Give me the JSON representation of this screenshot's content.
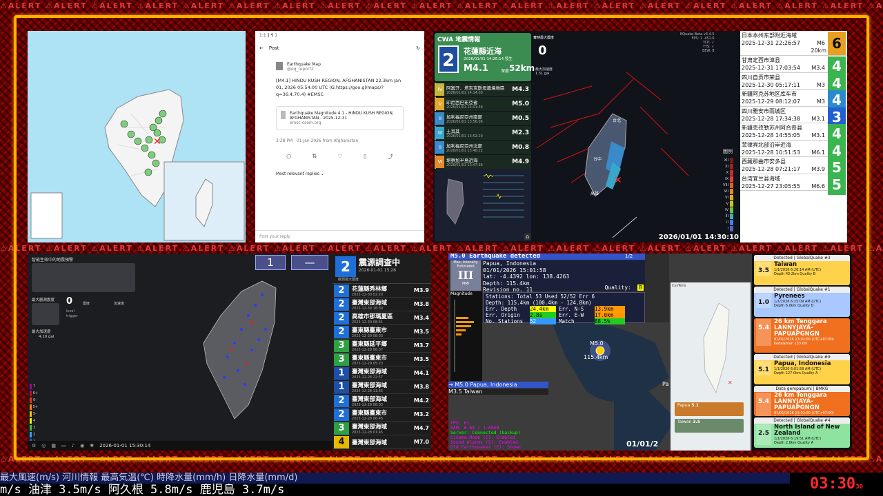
{
  "alert_word": "ALERT",
  "p2": {
    "status": "1:1 ‖ ¶ 1",
    "post": "Post",
    "account": "Earthquake Map",
    "handle": "@eq_report2",
    "body": "[M4.1] HINDU KUSH REGION, AFGHANISTAN 22.3km Jan 01, 2026 05:54:00 UTC (G:https://goo.gl/maps/?q=36.4,70.4) #EMSC",
    "quote_a": "Earthquake Magnitude 4.1 - HINDU KUSH REGION, AFGHANISTAN - 2025-12-31",
    "quote_b": "emsc-csem.org",
    "meta": "3:28 PM · 01 Jan 2026 from Afghanistan",
    "relevant": "Most relevant replies ⌄",
    "reply": "Post your reply"
  },
  "p3": {
    "header": "CWA 地震情報",
    "int": "2",
    "place": "花蓮縣近海",
    "dt": "2026/01/01 14:26:14 發生",
    "mag": "M4.1",
    "depth_l": "深度",
    "depth": "52km",
    "list": [
      {
        "i": "IV",
        "n": "阿富汗、塔吉克斯坦邊境地區",
        "m": "M4.3",
        "d": "2026/01/01 14:14:00",
        "c": "#c9b53a"
      },
      {
        "i": "V",
        "n": "印尼西巴布亞省",
        "m": "M5.0",
        "d": "2026/01/01 14:01:59",
        "c": "#e3a82a"
      },
      {
        "i": "II",
        "n": "加利福尼亞州南部",
        "m": "M0.5",
        "d": "2026/01/01 13:56:06",
        "c": "#3a8ac9"
      },
      {
        "i": "III",
        "n": "土耳其",
        "m": "M2.3",
        "d": "2026/01/01 13:52:20",
        "c": "#3aa6c9"
      },
      {
        "i": "II",
        "n": "加利福尼亞州北部",
        "m": "M0.8",
        "d": "2026/01/01 13:48:22",
        "c": "#3a8ac9"
      },
      {
        "i": "VI",
        "n": "堪察加半島近海",
        "m": "M4.9",
        "d": "2026/01/01 13:47:36",
        "c": "#e38a2a"
      }
    ],
    "zero": "0",
    "live": "實時最大震度",
    "pga_l": "最大加速度",
    "pga": "1.31 gal",
    "legend": "圖例",
    "legend_levels": [
      "XII",
      "XI",
      "X",
      "IX",
      "VIII",
      "VII",
      "VI",
      "V",
      "IV",
      "III",
      "II",
      "I"
    ],
    "ts": "2026/01/01 14:30:10",
    "info": "EQuake Beta v3.4.5\nFPS: 1  451.6\nTCP: ✓\nTTS: ✓\nEEW: 8",
    "city1": "台北",
    "city2": "台中",
    "city3": "高雄"
  },
  "list": [
    {
      "p": "日本本州东部附近海域",
      "t": "2025-12-31 22:26:57",
      "m": "M6",
      "d": "20km",
      "s": "6",
      "c": "#e8a020"
    },
    {
      "p": "甘肃定西市漳县",
      "t": "2025-12-31 17:03:54",
      "m": "M3.4",
      "s": "4",
      "c": "#3ab550"
    },
    {
      "p": "四川自贡市荣县",
      "t": "2025-12-30 05:17:11",
      "m": "M3",
      "s": "4",
      "c": "#3ab550"
    },
    {
      "p": "新疆阿克苏地区库车市",
      "t": "2025-12-29 08:12:07",
      "m": "M3",
      "s": "4",
      "c": "#2a8ad0"
    },
    {
      "p": "四川雅安市雨城区",
      "t": "2025-12-28 17:34:38",
      "m": "M3.1",
      "s": "3",
      "c": "#2060d0"
    },
    {
      "p": "新疆克孜勒苏州阿合奇县",
      "t": "2025-12-28 14:55:05",
      "m": "M3.1",
      "s": "4",
      "c": "#3ab550"
    },
    {
      "p": "菲律宾北部沿岸近海",
      "t": "2025-12-28 10:51:53",
      "m": "M6.1",
      "s": "4",
      "c": "#3ab550"
    },
    {
      "p": "西藏那曲市安多县",
      "t": "2025-12-28 07:21:17",
      "m": "M3.9",
      "s": "5",
      "c": "#3ab550"
    },
    {
      "p": "台湾宜兰县海域",
      "t": "2025-12-27 23:05:55",
      "m": "M6.6",
      "s": "5",
      "c": "#3ab550"
    }
  ],
  "p5": {
    "title": "智能生效中的地震預警",
    "lvl_l": "最大觀測震度",
    "zero": "0",
    "label_a": "震度",
    "label_b": "加速度",
    "lvl": "level",
    "trig": "trigger",
    "dash": "--",
    "pga_l": "最大加速度",
    "pga": "4.10 gal",
    "ts": "2026-01-01 15:30:14",
    "scale": [
      "7",
      "6+",
      "6-",
      "5+",
      "5-",
      "4",
      "3",
      "2",
      "1"
    ]
  },
  "p6": {
    "b1": "1",
    "b2": "—",
    "int": "2",
    "title": "震源調查中",
    "dt": "2026-01-01 15:26",
    "sub": "觀測最大震度",
    "rows": [
      {
        "s": "2",
        "n": "花蓮縣秀林鄉",
        "d": "2025-12-30 02:20",
        "m": "M3.9",
        "c": "#1e6fd8"
      },
      {
        "s": "2",
        "n": "臺灣東部海域",
        "d": "2025-12-30 16:39",
        "m": "M3.8",
        "c": "#1e6fd8"
      },
      {
        "s": "2",
        "n": "高雄市那瑪夏區",
        "d": "2025-12-30 08:41",
        "m": "M3.4",
        "c": "#1e6fd8"
      },
      {
        "s": "2",
        "n": "臺東縣臺東市",
        "d": "2025-12-29 08:03",
        "m": "M3.5",
        "c": "#1e6fd8"
      },
      {
        "s": "3",
        "n": "臺東縣延平鄉",
        "d": "2025-12-29 06:37",
        "m": "M3.7",
        "c": "#2ea043"
      },
      {
        "s": "3",
        "n": "臺東縣臺東市",
        "d": "2025-12-29 05:23",
        "m": "M3.5",
        "c": "#2ea043"
      },
      {
        "s": "1",
        "n": "臺灣東部海域",
        "d": "2025-12-28 22:57",
        "m": "M4.1",
        "c": "#1c4fa8"
      },
      {
        "s": "1",
        "n": "臺灣東部海域",
        "d": "2025-12-28 11:55",
        "m": "M3.8",
        "c": "#1c4fa8"
      },
      {
        "s": "2",
        "n": "臺灣東部海域",
        "d": "2025-12-28 08:03",
        "m": "M4.2",
        "c": "#1e6fd8"
      },
      {
        "s": "2",
        "n": "臺東縣臺東市",
        "d": "2025-12-28 06:45",
        "m": "M3.2",
        "c": "#1e6fd8"
      },
      {
        "s": "3",
        "n": "臺灣東部海域",
        "d": "2025-12-28 01:45",
        "m": "M4.7",
        "c": "#2ea043"
      },
      {
        "s": "4",
        "n": "臺灣東部海域",
        "d": "",
        "m": "M7.0",
        "c": "#e6b800"
      }
    ]
  },
  "p7": {
    "title": "M5.0 Earthquake detected",
    "page": "1/2",
    "mmi_l": "Max. Intensity",
    "mmi_e": "Estimated",
    "mmi": "III",
    "mmi_u": "MMI",
    "place": "Papua, Indonesia",
    "time": "01/01/2026 15:01:58",
    "latlon": "lat: -4.4392 lon: 138.4263",
    "depth": "Depth: 115.4km",
    "rev": "Revision no. 11",
    "quality": "Quality:",
    "quality_v": "B",
    "mag_l": "Magnitude",
    "stats": [
      "Stations: Total 53 Used 52/52 Err 6",
      "Depth: 115.4km (100.4km - 124.8km)"
    ],
    "err_d": "Err. Depth",
    "err_d_v": "24.4km",
    "err_ns": "Err. N-S",
    "err_ns_v": "13.9km",
    "err_o": "Err. Origin",
    "err_o_v": "2.8s",
    "err_ew": "Err. E-W",
    "err_ew_v": "17.0km",
    "nst": "No. Stations",
    "nst_v": "52",
    "match": "Match",
    "match_v": "88.5%",
    "epi_m": "M5.0",
    "epi_d": "115.4km",
    "list1": "→ M5.0 Papua, Indonesia",
    "list2": "M3.5 Taiwan",
    "stat": [
      "FPS: 61",
      "RAM: 0.64 / 1.00GB",
      "Server: Connected (backup)",
      "Cinema Mode (C): Enabled",
      "Sound Alarms (S): Enabled",
      "Old Earthquakes (E): Shown"
    ],
    "bottom": "01/01/2",
    "pl": "Pa"
  },
  "mini": {
    "app": "CysTeris",
    "c1": "Papua",
    "c1m": "5.1",
    "c2": "Taiwan",
    "c2m": "3.5"
  },
  "p8": [
    {
      "h": "Detected | GlobalQuake",
      "n": "#3",
      "m": "3.5",
      "place": "Taiwan",
      "t": "1/1/2026 6:26:14 AM (UTC)",
      "d": "Depth 43.2km",
      "q": "Quality B",
      "c": "#ffd24a",
      "tc": "#111"
    },
    {
      "h": "Detected | GlobalQuake",
      "n": "#1",
      "m": "1.0",
      "place": "Pyrenees",
      "t": "1/1/2026 6:25:09 AM (UTC)",
      "d": "Depth 6.0km",
      "q": "Quality D",
      "c": "#a8c8ff",
      "tc": "#111"
    },
    {
      "h": "",
      "n": "",
      "m": "5.4",
      "place": "26 km Tenggara LANNYJAYA-PAPUAPGNGN",
      "t": "01/01/2026 13:02:00 (UTC+07:00)",
      "d": "Kedalaman 133 km",
      "q": "",
      "c": "#f07020",
      "tc": "#fff"
    },
    {
      "h": "Detected | GlobalQuake",
      "n": "#9",
      "m": "5.1",
      "place": "Papua, Indonesia",
      "t": "1/1/2026 6:01:58 AM (UTC)",
      "d": "Depth 127.0km",
      "q": "Quality A",
      "c": "#ffd24a",
      "tc": "#111"
    },
    {
      "h": "Data gempabumi | BMKG",
      "n": "",
      "m": "5.4",
      "place": "26 km Tenggara LANNYJAYA-PAPUAPGNGN",
      "t": "01/01/2026 13:02:00 (UTC+07:00)",
      "d": "Kedalaman 133 km",
      "q": "",
      "c": "#f07020",
      "tc": "#fff"
    },
    {
      "h": "Detected | GlobalQuake",
      "n": "#4",
      "m": "2.5",
      "place": "North Island of New Zealand",
      "t": "1/1/2026 6:19:51 AM (UTC)",
      "d": "Depth 2.8km",
      "q": "Quality A",
      "c": "#8fe3a0",
      "tc": "#111"
    }
  ],
  "ticker": {
    "row1": "最大風速(m/s)  河川情報     最高気温(℃)     時降水量(mm/h)     日降水量(mm/d)",
    "row2": "m/s    油津 3.5m/s     阿久根 5.8m/s      鹿児島 3.7m/s",
    "clock": "03:30",
    "sec": "30"
  },
  "colors": {
    "frame": "#ffb000"
  }
}
